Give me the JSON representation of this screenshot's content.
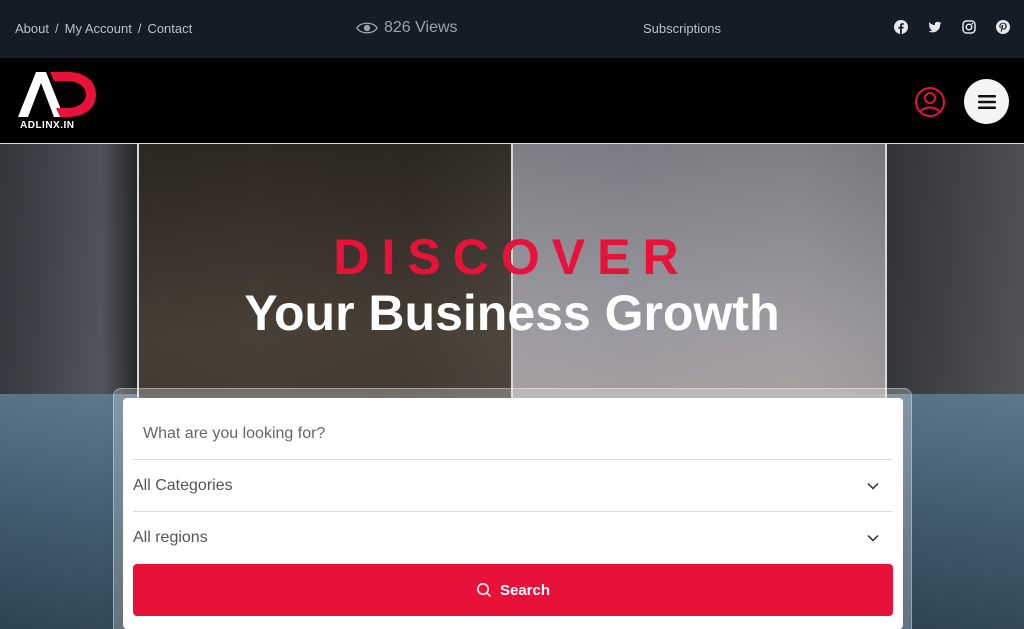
{
  "topbar": {
    "links": [
      "About",
      "My Account",
      "Contact"
    ],
    "views": "826 Views",
    "subscriptions": "Subscriptions",
    "social": [
      "facebook-icon",
      "twitter-icon",
      "instagram-icon",
      "pinterest-icon"
    ]
  },
  "header": {
    "logo_text": "ADLINX.IN"
  },
  "hero": {
    "headline_top": "DISCOVER",
    "headline_main": "Your Business Growth"
  },
  "search": {
    "placeholder": "What are you looking for?",
    "category": "All Categories",
    "region": "All regions",
    "button_label": "Search"
  },
  "colors": {
    "accent": "#e8113a",
    "topbar_bg": "#141c27"
  }
}
